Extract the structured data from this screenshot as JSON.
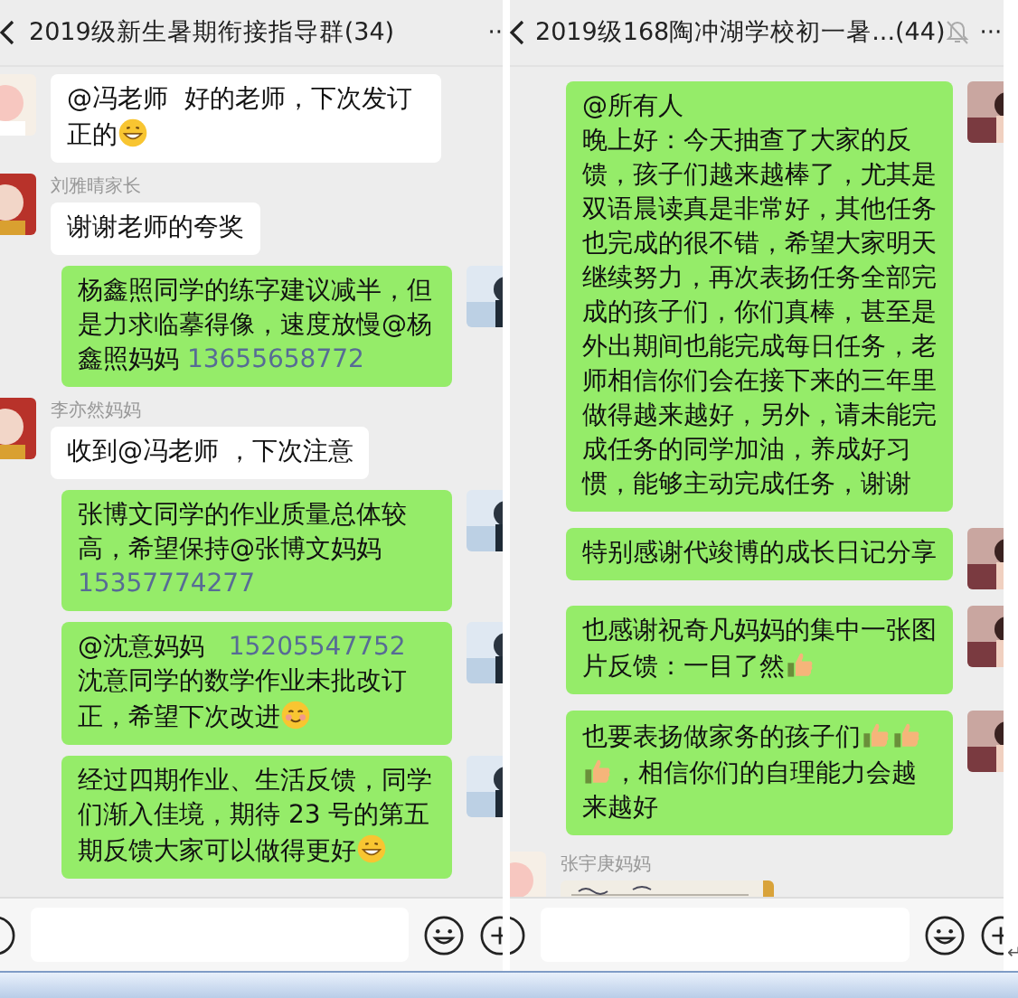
{
  "panels": [
    {
      "title": "2019级新生暑期衔接指导群(34)",
      "muted": false,
      "more": "··",
      "messages": [
        {
          "kind": "received",
          "parts": [
            {
              "kind": "text",
              "text": "@冯老师  好的老师，下次发订正的"
            },
            {
              "kind": "grin"
            }
          ]
        },
        {
          "kind": "received",
          "sender": "刘雅晴家长",
          "parts": [
            {
              "kind": "text",
              "text": "谢谢老师的夸奖"
            }
          ]
        },
        {
          "kind": "sent",
          "parts": [
            {
              "kind": "text",
              "text": "杨鑫照同学的练字建议减半，但是力求临摹得像，速度放慢@杨鑫照妈妈 "
            },
            {
              "kind": "phone",
              "text": "13655658772"
            }
          ]
        },
        {
          "kind": "received",
          "sender": "李亦然妈妈",
          "parts": [
            {
              "kind": "text",
              "text": "收到@冯老师 ，下次注意"
            }
          ]
        },
        {
          "kind": "sent",
          "parts": [
            {
              "kind": "text",
              "text": "张博文同学的作业质量总体较高，希望保持@张博文妈妈 "
            },
            {
              "kind": "phone",
              "text": "15357774277"
            }
          ]
        },
        {
          "kind": "sent",
          "parts": [
            {
              "kind": "text",
              "text": "@沈意妈妈   "
            },
            {
              "kind": "phone",
              "text": "15205547752"
            },
            {
              "kind": "text",
              "text": " 沈意同学的数学作业未批改订正，希望下次改进"
            },
            {
              "kind": "smile"
            }
          ]
        },
        {
          "kind": "sent",
          "parts": [
            {
              "kind": "text",
              "text": "经过四期作业、生活反馈，同学们渐入佳境，期待 23 号的第五期反馈大家可以做得更好"
            },
            {
              "kind": "grin"
            }
          ]
        }
      ]
    },
    {
      "title": "2019级168陶冲湖学校初一暑...(44)",
      "muted": true,
      "more": "···",
      "messages": [
        {
          "kind": "sent",
          "heading": "@所有人",
          "parts": [
            {
              "kind": "text",
              "text": "晚上好：今天抽查了大家的反馈，孩子们越来越棒了，尤其是双语晨读真是非常好，其他任务也完成的很不错，希望大家明天继续努力，再次表扬任务全部完成的孩子们，你们真棒，甚至是外出期间也能完成每日任务，老师相信你们会在接下来的三年里做得越来越好，另外，请未能完成任务的同学加油，养成好习惯，能够主动完成任务，谢谢"
            }
          ]
        },
        {
          "kind": "sent",
          "parts": [
            {
              "kind": "text",
              "text": "特别感谢代竣博的成长日记分享"
            }
          ]
        },
        {
          "kind": "sent",
          "parts": [
            {
              "kind": "text",
              "text": "也感谢祝奇凡妈妈的集中一张图片反馈：一目了然"
            },
            {
              "kind": "thumb"
            }
          ]
        },
        {
          "kind": "sent",
          "parts": [
            {
              "kind": "text",
              "text": "也要表扬做家务的孩子们"
            },
            {
              "kind": "thumb"
            },
            {
              "kind": "thumb"
            },
            {
              "kind": "thumb"
            },
            {
              "kind": "text",
              "text": "，相信你们的自理能力会越来越好"
            }
          ]
        },
        {
          "sender": "张宇庚妈妈"
        }
      ]
    }
  ],
  "return_mark": "↵"
}
